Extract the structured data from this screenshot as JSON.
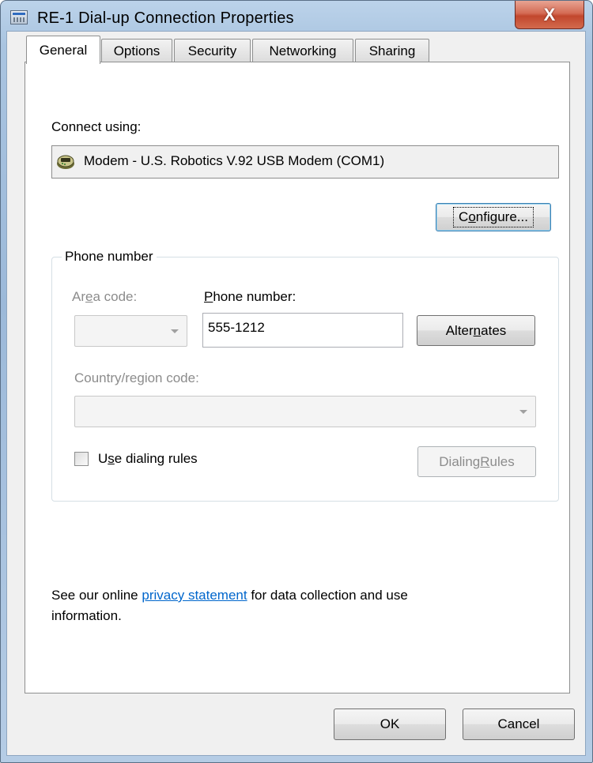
{
  "window": {
    "title": "RE-1 Dial-up Connection Properties",
    "close_glyph": "X"
  },
  "tabs": [
    {
      "label": "General",
      "active": true
    },
    {
      "label": "Options",
      "active": false
    },
    {
      "label": "Security",
      "active": false
    },
    {
      "label": "Networking",
      "active": false
    },
    {
      "label": "Sharing",
      "active": false
    }
  ],
  "general": {
    "connect_using_label": "Connect using:",
    "device_name": "Modem - U.S. Robotics V.92 USB Modem (COM1)",
    "device_icon": "modem-icon",
    "configure_pre": "C",
    "configure_mnemonic": "o",
    "configure_post": "nfigure...",
    "phone_group": {
      "legend": "Phone number",
      "area_code_pre": "Ar",
      "area_code_mnemonic": "e",
      "area_code_post": "a code:",
      "area_code_value": "",
      "phone_label_mnemonic": "P",
      "phone_label_post": "hone number:",
      "phone_value": "555-1212",
      "alternates_pre": "Alter",
      "alternates_mnemonic": "n",
      "alternates_post": "ates",
      "country_label": "Country/region code:",
      "country_value": "",
      "dialing_rules_pre": "U",
      "dialing_rules_mnemonic": "s",
      "dialing_rules_post": "e dialing rules",
      "dialing_rules_checked": false,
      "dialing_rules_btn_pre": "Dialing ",
      "dialing_rules_btn_mnemonic": "R",
      "dialing_rules_btn_post": "ules"
    },
    "privacy": {
      "before": "See our online ",
      "link": "privacy statement",
      "after": " for data collection and use",
      "line2": "information."
    }
  },
  "footer": {
    "ok_label": "OK",
    "cancel_label": "Cancel"
  },
  "colors": {
    "link": "#0066cc",
    "close_button": "#c2472e",
    "title_gradient": "#9cb9d9"
  }
}
